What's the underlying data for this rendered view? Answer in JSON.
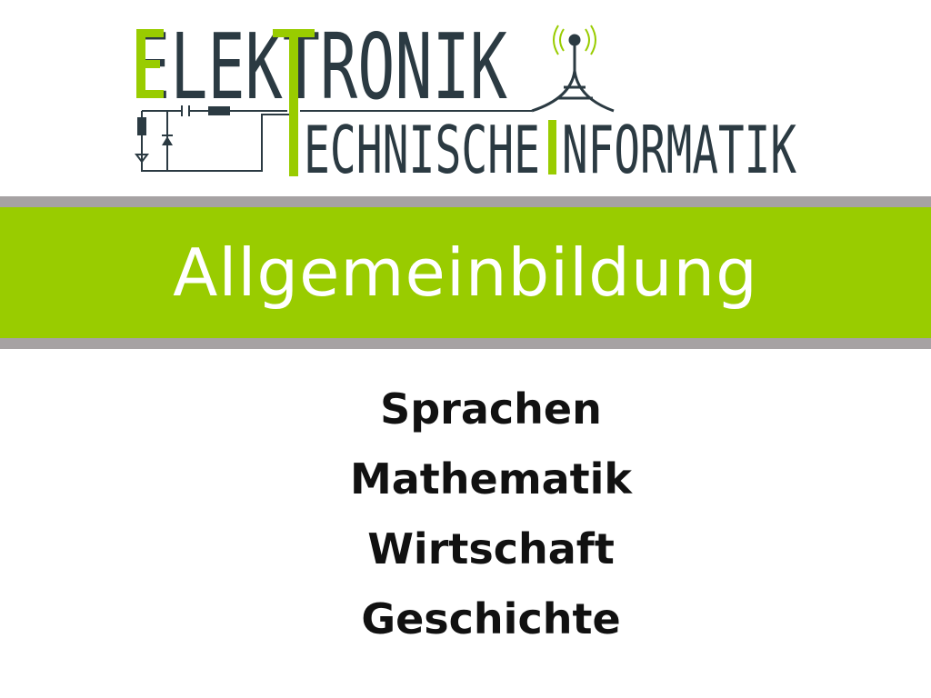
{
  "logo": {
    "line1": "ELEKTRONIK",
    "line2_part1": "ECHNISCHE",
    "line2_part2": "NFORMATIK",
    "colors": {
      "dark": "#2b3a42",
      "green": "#99cc00",
      "grey": "#666666"
    }
  },
  "banner": {
    "title": "Allgemeinbildung",
    "color": "#99cc00",
    "border_color": "#a6a2a3"
  },
  "subjects": [
    "Sprachen",
    "Mathematik",
    "Wirtschaft",
    "Geschichte"
  ]
}
